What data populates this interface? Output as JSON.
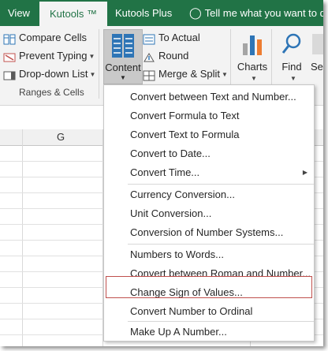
{
  "tabs": {
    "view": "View",
    "kutools": "Kutools ™",
    "kutools_plus": "Kutools Plus",
    "tell_me": "Tell me what you want to do"
  },
  "ribbon": {
    "compare_cells": "Compare Cells",
    "prevent_typing": "Prevent Typing",
    "dropdown_list": "Drop-down List",
    "group_label": "Ranges & Cells",
    "content": "Content",
    "to_actual": "To Actual",
    "round": "Round",
    "merge_split": "Merge & Split",
    "charts": "Charts",
    "find": "Find",
    "se_partial": "Se"
  },
  "sheet": {
    "column_g": "G"
  },
  "menu": {
    "items": [
      "Convert between Text and Number...",
      "Convert Formula to Text",
      "Convert Text to Formula",
      "Convert to Date...",
      "Convert Time...",
      "Currency Conversion...",
      "Unit Conversion...",
      "Conversion of Number Systems...",
      "Numbers to Words...",
      "Convert between Roman and Number...",
      "Change Sign of Values...",
      "Convert Number to Ordinal",
      "Make Up A Number..."
    ],
    "highlighted_item": "Change Sign of Values..."
  },
  "colors": {
    "accent": "#217346",
    "highlight_border": "#c0504d",
    "ribbon_bg": "#f3f3f3"
  }
}
